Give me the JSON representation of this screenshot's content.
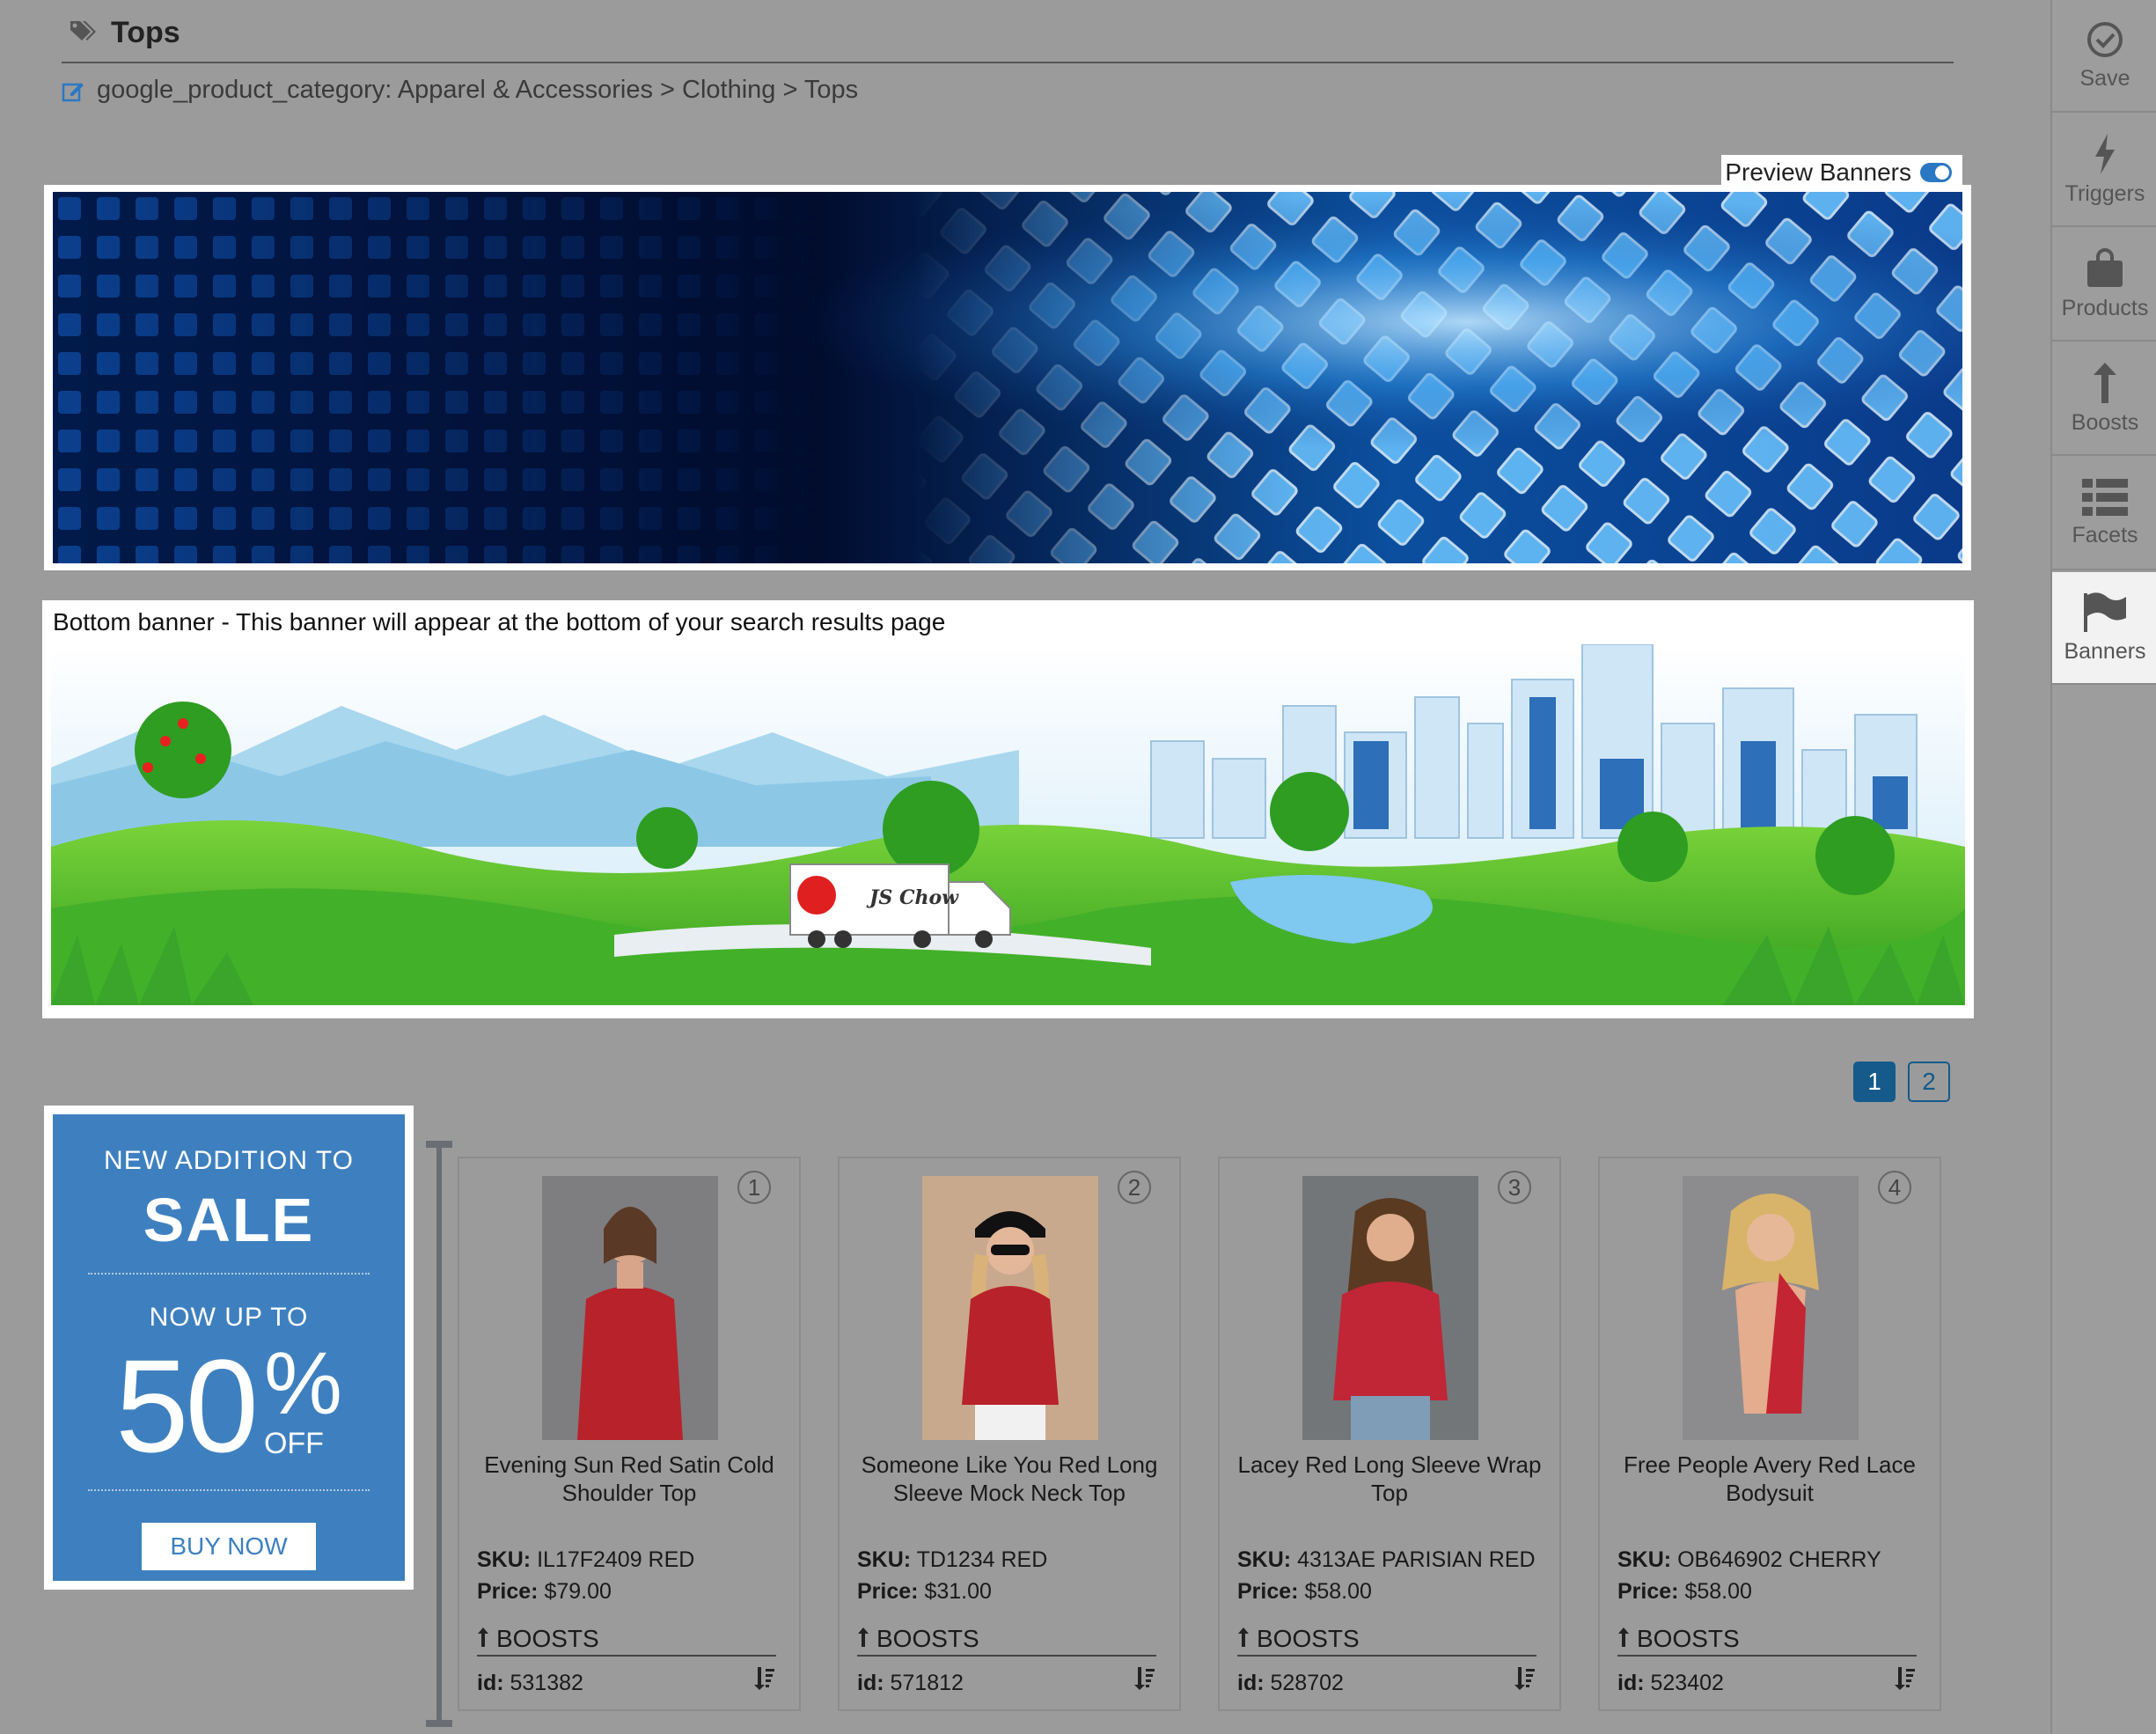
{
  "header": {
    "title": "Tops",
    "breadcrumb": "google_product_category: Apparel & Accessories > Clothing > Tops"
  },
  "preview": {
    "label": "Preview Banners",
    "enabled": true
  },
  "banners": {
    "bottom_caption": "Bottom banner - This banner will appear at the bottom of your search results page",
    "truck_brand": "JS Chow"
  },
  "sale_banner": {
    "line1": "NEW ADDITION TO",
    "line2": "SALE",
    "line3": "NOW UP TO",
    "percent": "50",
    "percent_sign": "%",
    "off": "OFF",
    "button": "BUY NOW"
  },
  "pagination": {
    "pages": [
      "1",
      "2"
    ],
    "current": "1"
  },
  "labels": {
    "sku": "SKU:",
    "price": "Price:",
    "boosts": "BOOSTS",
    "id": "id:"
  },
  "products": [
    {
      "position": "1",
      "name": "Evening Sun Red Satin Cold Shoulder Top",
      "sku": "IL17F2409 RED",
      "price": "$79.00",
      "id": "531382"
    },
    {
      "position": "2",
      "name": "Someone Like You Red Long Sleeve Mock Neck Top",
      "sku": "TD1234 RED",
      "price": "$31.00",
      "id": "571812"
    },
    {
      "position": "3",
      "name": "Lacey Red Long Sleeve Wrap Top",
      "sku": "4313AE PARISIAN RED",
      "price": "$58.00",
      "id": "528702"
    },
    {
      "position": "4",
      "name": "Free People Avery Red Lace Bodysuit",
      "sku": "OB646902 CHERRY",
      "price": "$58.00",
      "id": "523402"
    }
  ],
  "sidebar": {
    "items": [
      {
        "label": "Save",
        "icon": "check-circle-icon"
      },
      {
        "label": "Triggers",
        "icon": "bolt-icon"
      },
      {
        "label": "Products",
        "icon": "shopping-bag-icon"
      },
      {
        "label": "Boosts",
        "icon": "boost-arrow-icon"
      },
      {
        "label": "Facets",
        "icon": "list-icon"
      },
      {
        "label": "Banners",
        "icon": "flag-icon"
      }
    ],
    "active": "Banners"
  },
  "colors": {
    "background": "#9b9b9b",
    "accent": "#155a8a",
    "sale_blue": "#3e80bf",
    "toggle": "#2b78c2"
  }
}
